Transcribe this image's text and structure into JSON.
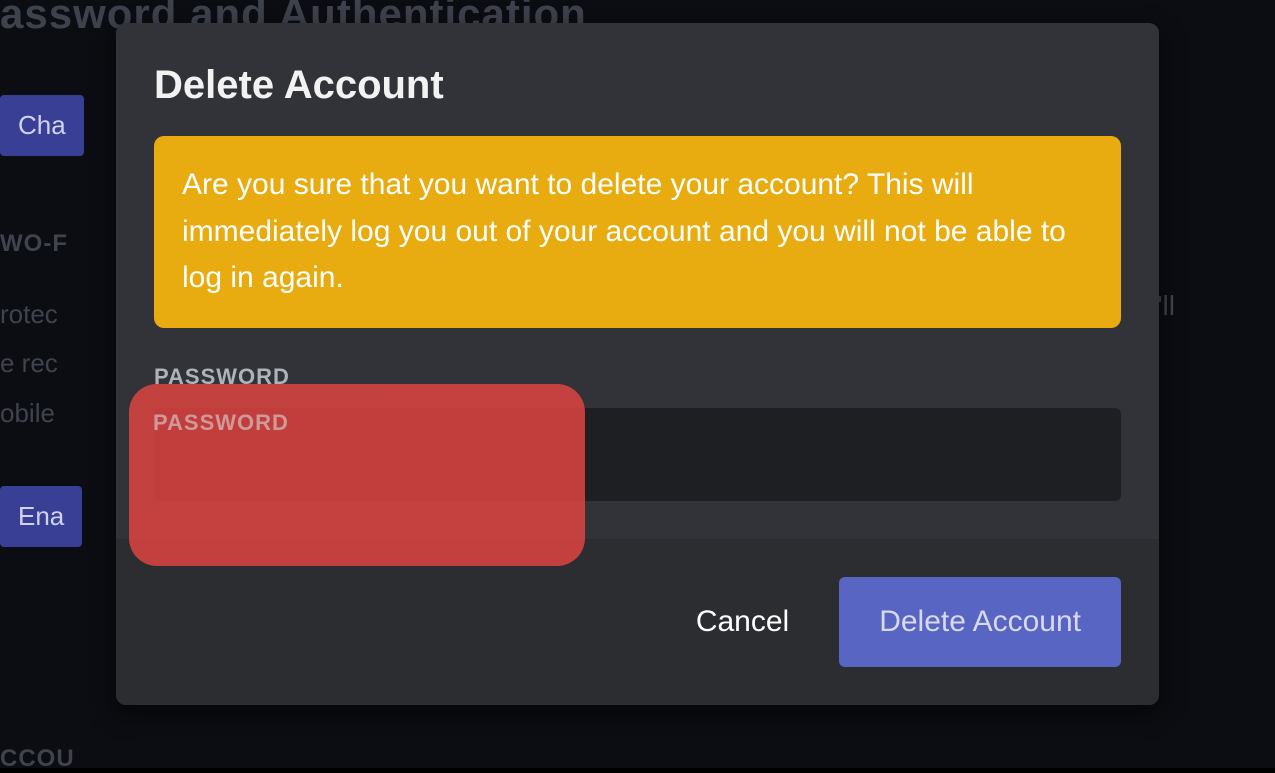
{
  "background": {
    "heading": "assword and Authentication",
    "button1": "Cha",
    "twoFactor": "WO-F",
    "protectText": "rotec\ne rec\nobile",
    "youllText": "u'll",
    "button2": "Ena",
    "accountRemoval": "CCOU"
  },
  "modal": {
    "title": "Delete Account",
    "warning": "Are you sure that you want to delete your account? This will immediately log you out of your account and you will not be able to log in again.",
    "passwordLabel": "PASSWORD",
    "passwordValue": "",
    "footer": {
      "cancel": "Cancel",
      "delete": "Delete Account"
    }
  },
  "annotation": {
    "redLabel": "PASSWORD"
  }
}
